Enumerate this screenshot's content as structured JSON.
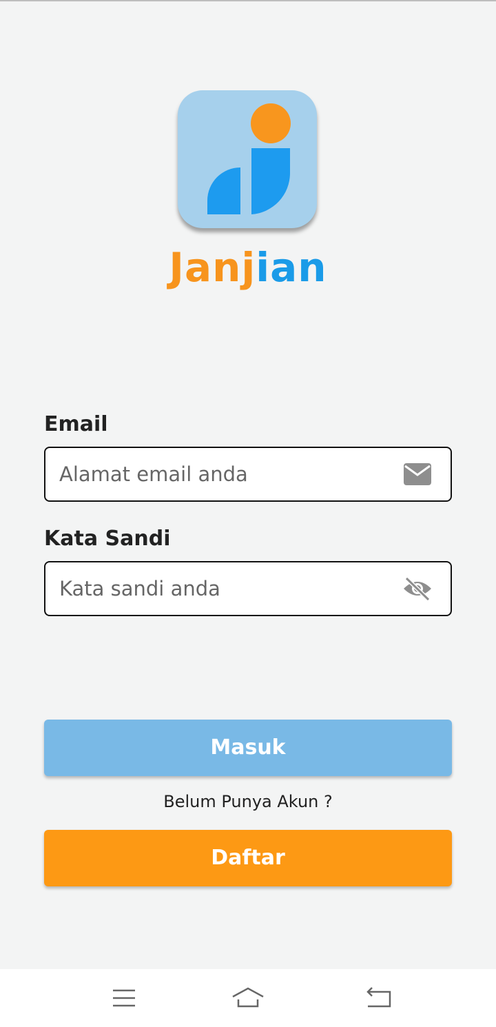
{
  "app": {
    "brand_part1": "Janj",
    "brand_part2": "ian",
    "logo_icon": "janjian-logo-icon",
    "colors": {
      "orange": "#f7941d",
      "blue": "#1a9be8",
      "logo_bg": "#a6d0ec",
      "background": "#f3f4f4"
    }
  },
  "form": {
    "email": {
      "label": "Email",
      "placeholder": "Alamat email anda",
      "value": "",
      "icon": "mail-icon"
    },
    "password": {
      "label": "Kata Sandi",
      "placeholder": "Kata sandi anda",
      "value": "",
      "icon": "eye-off-icon"
    }
  },
  "actions": {
    "login_label": "Masuk",
    "no_account_text": "Belum Punya Akun ?",
    "register_label": "Daftar",
    "login_color": "#79b9e6",
    "register_color": "#fd9914"
  },
  "system_nav": {
    "menu_icon": "menu-icon",
    "home_icon": "home-icon",
    "back_icon": "back-icon"
  }
}
